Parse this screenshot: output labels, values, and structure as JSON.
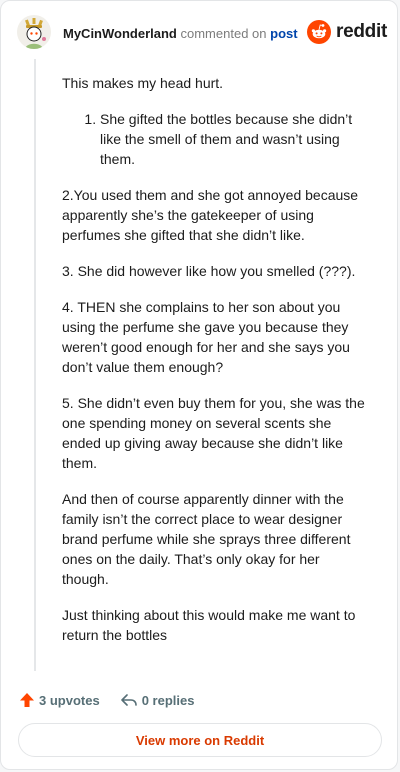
{
  "header": {
    "username": "MyCinWonderland",
    "action_text": "commented on",
    "post_link": "post",
    "logo_wordmark": "reddit"
  },
  "comment": {
    "intro": "This makes my head hurt.",
    "numbered_item": "She gifted the bottles because she didn’t like the smell of them and wasn’t using them.",
    "paragraphs": [
      "2.You used them and she got annoyed because apparently she’s the gatekeeper of using perfumes she gifted that she didn’t like.",
      "3. She did however like how you smelled (???).",
      "4. THEN she complains to her son about you using the perfume she gave you because they weren’t good enough for her and she says you don’t value them enough?",
      "5. She didn’t even buy them for you, she was the one spending money on several scents she ended up giving away because she didn’t like them.",
      "And then of course apparently dinner with the family isn’t the correct place to wear designer brand perfume while she sprays three different ones on the daily. That’s only okay for her though.",
      "Just thinking about this would make me want to return the bottles"
    ]
  },
  "actions": {
    "upvotes": "3 upvotes",
    "replies": "0 replies"
  },
  "footer": {
    "view_more": "View more on Reddit"
  },
  "colors": {
    "brand": "#ff4500",
    "link": "#0045ac",
    "cta": "#d93a00",
    "muted": "#576f76"
  },
  "icons": {
    "avatar": "user-avatar",
    "logo": "reddit-snoo-icon",
    "upvote": "upvote-arrow-icon",
    "reply": "reply-arrow-icon"
  }
}
